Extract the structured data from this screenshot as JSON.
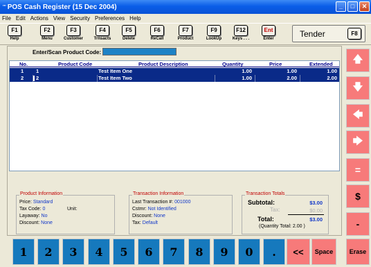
{
  "window": {
    "title": "POS Cash Register   (15 Dec 2004)",
    "app_icon": "\"\""
  },
  "menu": [
    "File",
    "Edit",
    "Actions",
    "View",
    "Security",
    "Preferences",
    "Help"
  ],
  "toolbar": {
    "keys": [
      {
        "key": "F1",
        "label": "Help"
      },
      {
        "key": "F2",
        "label": "Menu"
      },
      {
        "key": "F3",
        "label": "Customer"
      },
      {
        "key": "F4",
        "label": "Trnsacts"
      },
      {
        "key": "F5",
        "label": "Delete"
      },
      {
        "key": "F6",
        "label": "ReCall"
      },
      {
        "key": "F7",
        "label": "Product"
      },
      {
        "key": "F9",
        "label": "LookUp"
      },
      {
        "key": "F12",
        "label": "Keys . . ."
      },
      {
        "key": "Ent",
        "label": "Enter"
      }
    ],
    "tender": {
      "label": "Tender",
      "key": "F8"
    }
  },
  "scan": {
    "label": "Enter/Scan Product Code:",
    "value": ""
  },
  "grid": {
    "columns": [
      "No.",
      "Product Code",
      "Product Description",
      "Quantity",
      "Price",
      "Extended"
    ],
    "rows": [
      {
        "no": "1",
        "code": "1",
        "desc": "Test Item One",
        "qty": "1.00",
        "price": "1.00",
        "ext": "1.00"
      },
      {
        "no": "2",
        "code": "2",
        "desc": "Test Item Two",
        "qty": "1.00",
        "price": "2.00",
        "ext": "2.00"
      }
    ],
    "row_color": "#0a2a88"
  },
  "product_info": {
    "title": "Product Information",
    "price_label": "Price:",
    "price_value": "Standard",
    "taxcode_label": "Tax Code:",
    "taxcode_value": "0",
    "unit_label": "Unit:",
    "layaway_label": "Layaway:",
    "layaway_value": "No",
    "discount_label": "Discount:",
    "discount_value": "None"
  },
  "transaction_info": {
    "title": "Transaction Information",
    "last_label": "Last Transaction #:",
    "last_value": "001000",
    "cstmr_label": "Cstmr:",
    "cstmr_value": "Not Identified",
    "discount_label": "Discount:",
    "discount_value": "None",
    "tax_label": "Tax:",
    "tax_value": "Default"
  },
  "totals": {
    "title": "Transaction Totals",
    "subtotal_label": "Subtotal:",
    "subtotal_value": "$3.00",
    "tax_label": "Tax:",
    "tax_value": "$0.00",
    "total_label": "Total:",
    "total_value": "$3.00",
    "quantity_note": "(Quantity Total: 2.00 )"
  },
  "right_buttons": [
    {
      "name": "arrow-up",
      "glyph": "🡅"
    },
    {
      "name": "arrow-down",
      "glyph": "🡇"
    },
    {
      "name": "arrow-left",
      "glyph": "🡄"
    },
    {
      "name": "arrow-right",
      "glyph": "🡆"
    },
    {
      "name": "equals",
      "glyph": "="
    },
    {
      "name": "dollar",
      "glyph": "$"
    },
    {
      "name": "minus",
      "glyph": "-"
    }
  ],
  "numpad": [
    "1",
    "2",
    "3",
    "4",
    "5",
    "6",
    "7",
    "8",
    "9",
    "0",
    ".",
    "<<",
    "Space"
  ],
  "erase_label": "Erase",
  "colors": {
    "accent_red": "#f77a7a",
    "keypad_blue": "#1679bd",
    "selected_row": "#0a2a88"
  }
}
